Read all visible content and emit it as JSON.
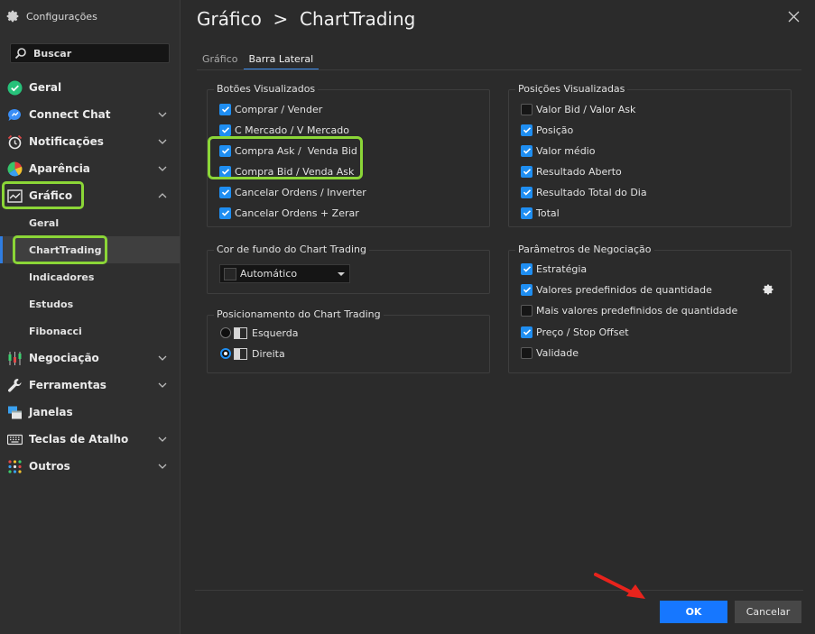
{
  "sidebar": {
    "header": "Configurações",
    "search_placeholder": "Buscar",
    "items": [
      {
        "label": "Geral"
      },
      {
        "label": "Connect Chat"
      },
      {
        "label": "Notificações"
      },
      {
        "label": "Aparência"
      },
      {
        "label": "Gráfico"
      },
      {
        "label": "Negociação"
      },
      {
        "label": "Ferramentas"
      },
      {
        "label": "Janelas"
      },
      {
        "label": "Teclas de Atalho"
      },
      {
        "label": "Outros"
      }
    ],
    "sub_items": [
      {
        "label": "Geral"
      },
      {
        "label": "ChartTrading"
      },
      {
        "label": "Indicadores"
      },
      {
        "label": "Estudos"
      },
      {
        "label": "Fibonacci"
      }
    ]
  },
  "main": {
    "title": "Gráfico  >  ChartTrading",
    "tabs": [
      {
        "label": "Gráfico",
        "active": false
      },
      {
        "label": "Barra Lateral",
        "active": true
      }
    ],
    "buttons_group": {
      "title": "Botões Visualizados",
      "items": [
        {
          "label": "Comprar / Vender",
          "checked": true
        },
        {
          "label": "C Mercado / V Mercado",
          "checked": true
        },
        {
          "label": "Compra Ask /  Venda Bid",
          "checked": true
        },
        {
          "label": "Compra Bid / Venda Ask",
          "checked": true
        },
        {
          "label": "Cancelar Ordens / Inverter",
          "checked": true
        },
        {
          "label": "Cancelar Ordens + Zerar",
          "checked": true
        }
      ]
    },
    "positions_group": {
      "title": "Posições Visualizadas",
      "items": [
        {
          "label": "Valor Bid / Valor Ask",
          "checked": false
        },
        {
          "label": "Posição",
          "checked": true
        },
        {
          "label": "Valor médio",
          "checked": true
        },
        {
          "label": "Resultado Aberto",
          "checked": true
        },
        {
          "label": "Resultado Total do Dia",
          "checked": true
        },
        {
          "label": "Total",
          "checked": true
        }
      ]
    },
    "bg_group": {
      "title": "Cor de fundo do Chart Trading",
      "selected": "Automático"
    },
    "position_group": {
      "title": "Posicionamento do Chart Trading",
      "options": [
        {
          "label": "Esquerda",
          "selected": false
        },
        {
          "label": "Direita",
          "selected": true
        }
      ]
    },
    "negotiation_group": {
      "title": "Parâmetros de Negociação",
      "items": [
        {
          "label": "Estratégia",
          "checked": true
        },
        {
          "label": "Valores predefinidos de quantidade",
          "checked": true
        },
        {
          "label": "Mais valores predefinidos de quantidade",
          "checked": false
        },
        {
          "label": "Preço / Stop Offset",
          "checked": true
        },
        {
          "label": "Validade",
          "checked": false
        }
      ]
    }
  },
  "footer": {
    "ok_label": "OK",
    "cancel_label": "Cancelar"
  },
  "colors": {
    "accent": "#1f8ef1",
    "highlight": "#8bd637",
    "arrow": "#e8231c"
  }
}
